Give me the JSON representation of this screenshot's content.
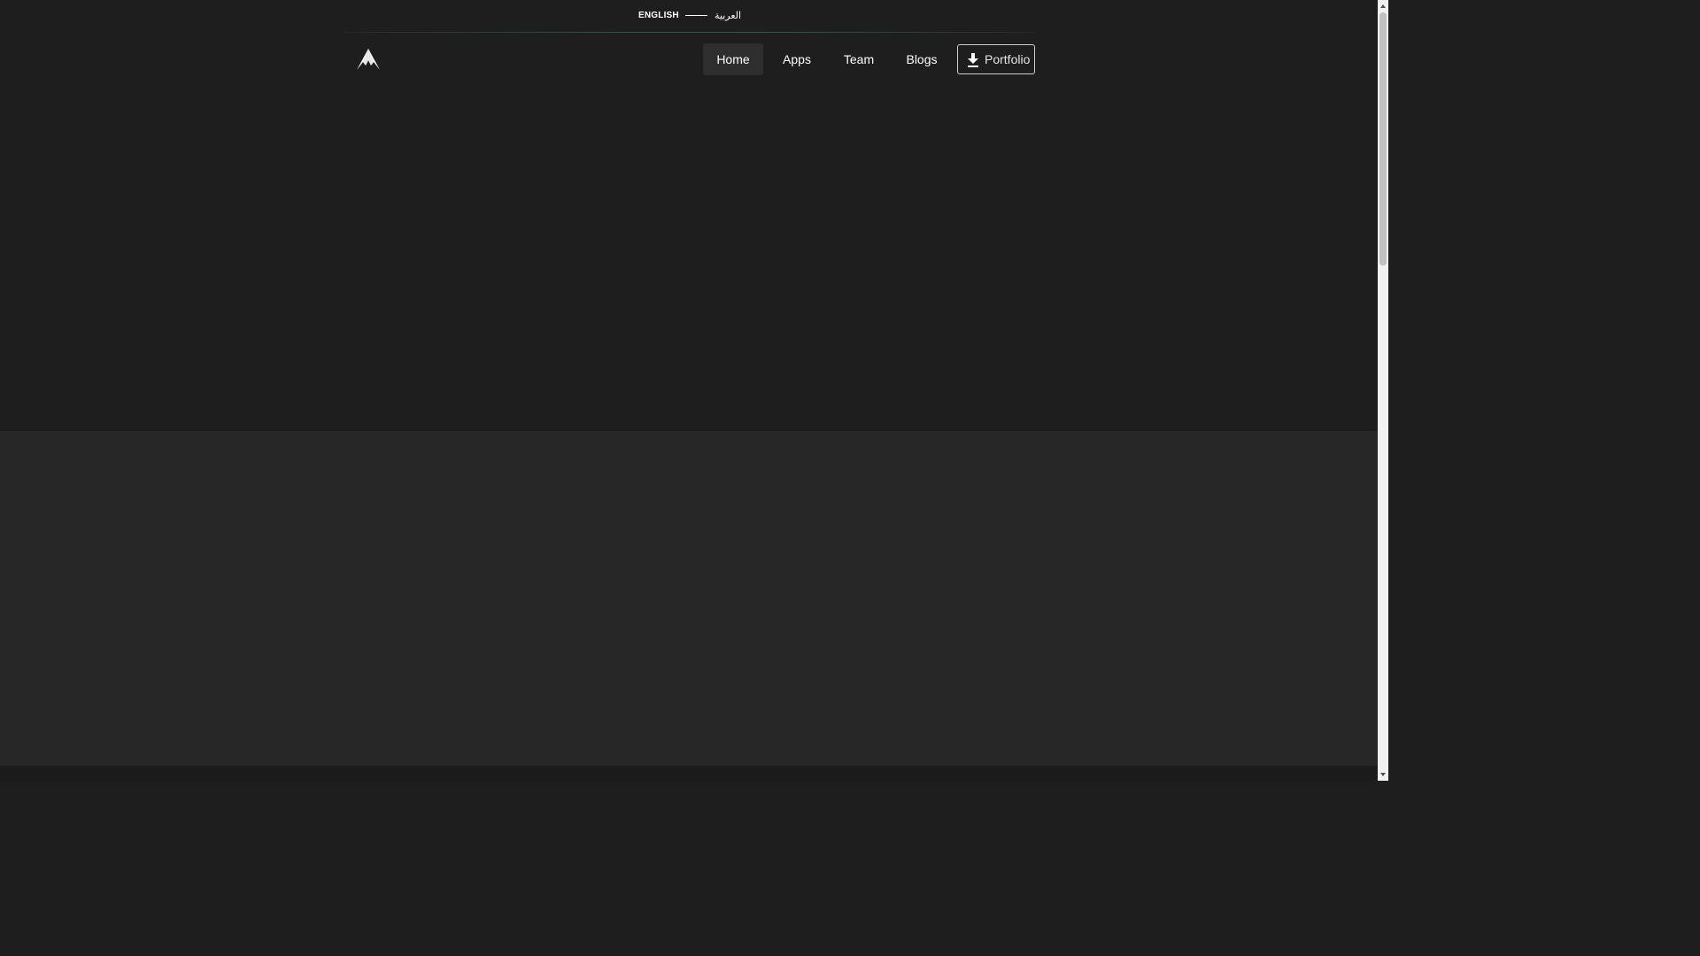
{
  "language": {
    "english_label": "ENGLISH",
    "arabic_label": "العربية"
  },
  "logo": {
    "icon": "mountain-logo-icon"
  },
  "nav": {
    "items": [
      {
        "label": "Home",
        "active": true
      },
      {
        "label": "Apps",
        "active": false
      },
      {
        "label": "Team",
        "active": false
      },
      {
        "label": "Blogs",
        "active": false
      }
    ],
    "portfolio": {
      "label": "Portfolio",
      "icon": "download-icon"
    }
  },
  "colors": {
    "hero_bg": "#1e1e1e",
    "section_bg": "#272727",
    "footer_bg": "#1c1c1c",
    "accent_divider": "#2d5a4c",
    "active_nav_bg": "#2e2e2e"
  }
}
